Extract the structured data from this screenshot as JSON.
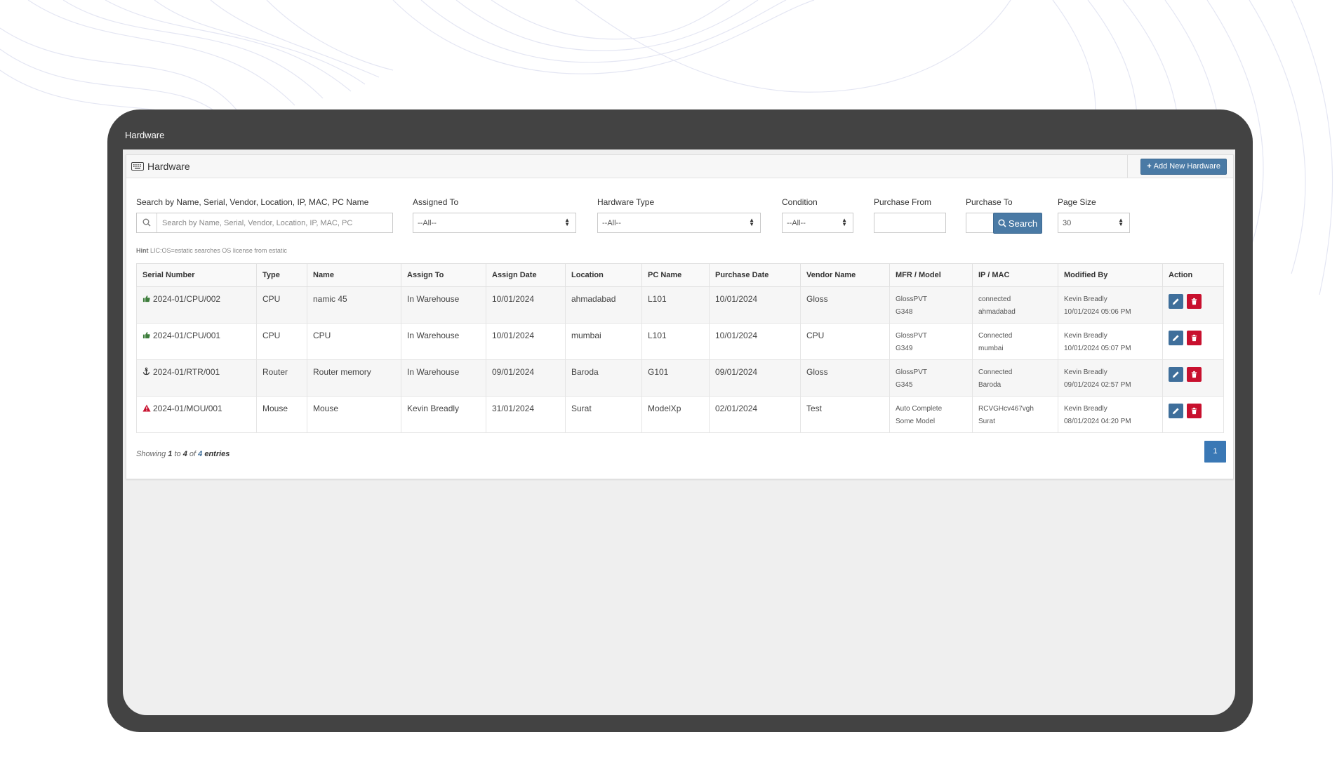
{
  "window": {
    "title": "Hardware"
  },
  "panel": {
    "title": "Hardware",
    "add_button": "Add New Hardware"
  },
  "filters": {
    "search": {
      "label": "Search by Name, Serial, Vendor, Location, IP, MAC, PC Name",
      "placeholder": "Search by Name, Serial, Vendor, Location, IP, MAC, PC"
    },
    "assigned_to": {
      "label": "Assigned To",
      "value": "--All--"
    },
    "hardware_type": {
      "label": "Hardware Type",
      "value": "--All--"
    },
    "condition": {
      "label": "Condition",
      "value": "--All--"
    },
    "purchase_from": {
      "label": "Purchase From",
      "value": ""
    },
    "purchase_to": {
      "label": "Purchase To",
      "value": ""
    },
    "page_size": {
      "label": "Page Size",
      "value": "30"
    },
    "search_button": "Search",
    "hint_label": "Hint",
    "hint_text": "LIC:OS=estatic searches OS license from estatic"
  },
  "table": {
    "columns": [
      "Serial Number",
      "Type",
      "Name",
      "Assign To",
      "Assign Date",
      "Location",
      "PC Name",
      "Purchase Date",
      "Vendor Name",
      "MFR / Model",
      "IP / MAC",
      "Modified By",
      "Action"
    ],
    "rows": [
      {
        "status_icon": "thumbs-up-icon",
        "serial": "2024-01/CPU/002",
        "type": "CPU",
        "name": "namic 45",
        "assign_to": "In Warehouse",
        "assign_date": "10/01/2024",
        "location": "ahmadabad",
        "pc_name": "L101",
        "purchase_date": "10/01/2024",
        "vendor": "Gloss",
        "mfr": "GlossPVT",
        "model": "G348",
        "ip": "connected",
        "mac": "ahmadabad",
        "modified_by": "Kevin Breadly",
        "modified_at": "10/01/2024 05:06 PM"
      },
      {
        "status_icon": "thumbs-up-icon",
        "serial": "2024-01/CPU/001",
        "type": "CPU",
        "name": "CPU",
        "assign_to": "In Warehouse",
        "assign_date": "10/01/2024",
        "location": "mumbai",
        "pc_name": "L101",
        "purchase_date": "10/01/2024",
        "vendor": "CPU",
        "mfr": "GlossPVT",
        "model": "G349",
        "ip": "Connected",
        "mac": "mumbai",
        "modified_by": "Kevin Breadly",
        "modified_at": "10/01/2024 05:07 PM"
      },
      {
        "status_icon": "anchor-icon",
        "serial": "2024-01/RTR/001",
        "type": "Router",
        "name": "Router memory",
        "assign_to": "In Warehouse",
        "assign_date": "09/01/2024",
        "location": "Baroda",
        "pc_name": "G101",
        "purchase_date": "09/01/2024",
        "vendor": "Gloss",
        "mfr": "GlossPVT",
        "model": "G345",
        "ip": "Connected",
        "mac": "Baroda",
        "modified_by": "Kevin Breadly",
        "modified_at": "09/01/2024 02:57 PM"
      },
      {
        "status_icon": "warning-icon",
        "serial": "2024-01/MOU/001",
        "type": "Mouse",
        "name": "Mouse",
        "assign_to": "Kevin Breadly",
        "assign_date": "31/01/2024",
        "location": "Surat",
        "pc_name": "ModelXp",
        "purchase_date": "02/01/2024",
        "vendor": "Test",
        "mfr": "Auto Complete",
        "model": "Some Model",
        "ip": "RCVGHcv467vgh",
        "mac": "Surat",
        "modified_by": "Kevin Breadly",
        "modified_at": "08/01/2024 04:20 PM"
      }
    ]
  },
  "footer": {
    "showing": "Showing",
    "from": "1",
    "to_word": "to",
    "to": "4",
    "of_word": "of",
    "total": "4",
    "entries": "entries",
    "page": "1"
  },
  "colors": {
    "primary": "#4a7aa5",
    "delete": "#c8102e",
    "frame": "#434343",
    "page_active": "#3a78b5"
  }
}
